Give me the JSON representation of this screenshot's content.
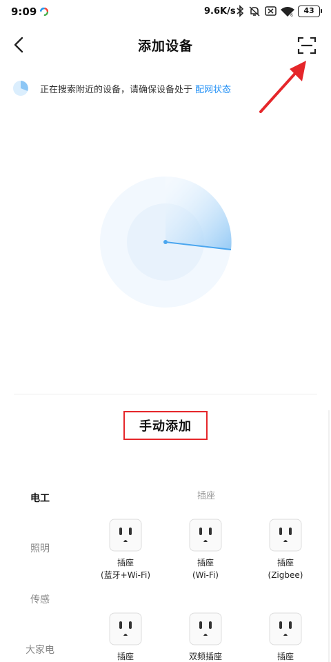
{
  "status_bar": {
    "time": "9:09",
    "speed": "9.6K/s",
    "battery": "43"
  },
  "header": {
    "title": "添加设备"
  },
  "search_hint": {
    "text": "正在搜索附近的设备，请确保设备处于",
    "link": "配网状态"
  },
  "manual_add": {
    "label": "手动添加"
  },
  "categories": [
    {
      "label": "电工",
      "active": true
    },
    {
      "label": "照明",
      "active": false
    },
    {
      "label": "传感",
      "active": false
    },
    {
      "label": "大家电",
      "active": false
    }
  ],
  "section": {
    "title": "插座"
  },
  "devices": [
    {
      "name": "插座",
      "sub": "(蓝牙+Wi-Fi)",
      "icon": "socket-icon"
    },
    {
      "name": "插座",
      "sub": "(Wi-Fi)",
      "icon": "socket-icon"
    },
    {
      "name": "插座",
      "sub": "(Zigbee)",
      "icon": "socket-icon"
    },
    {
      "name": "插座",
      "sub": "",
      "icon": "socket-icon"
    },
    {
      "name": "双频插座",
      "sub": "",
      "icon": "socket-icon"
    },
    {
      "name": "插座",
      "sub": "",
      "icon": "socket-icon"
    }
  ],
  "colors": {
    "accent": "#1e8ef5",
    "annotation_red": "#e5262a",
    "radar_light": "#eaf3fd",
    "radar_sweep": "#8cc6f5"
  },
  "icons": {
    "back": "chevron-left-icon",
    "scan": "scan-icon",
    "hint": "radar-status-icon"
  }
}
